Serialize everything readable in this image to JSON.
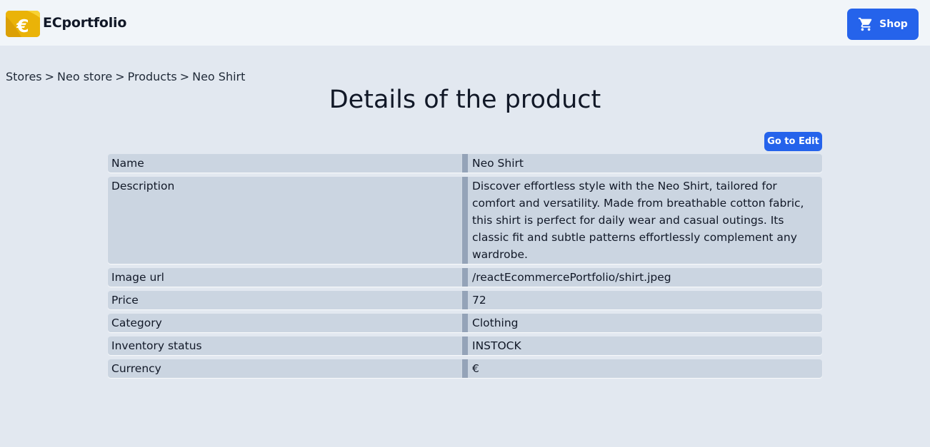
{
  "header": {
    "brand": "ECportfolio",
    "logo_icon": "euro-wallet-icon",
    "logo_color": "#eab308",
    "shop_label": "Shop",
    "shop_icon": "cart-icon",
    "accent_color": "#2563eb"
  },
  "breadcrumb": {
    "items": [
      "Stores",
      "Neo store",
      "Products",
      "Neo Shirt"
    ],
    "separator": ">"
  },
  "page": {
    "title": "Details of the product",
    "edit_label": "Go to Edit"
  },
  "details": [
    {
      "label": "Name",
      "value": "Neo Shirt"
    },
    {
      "label": "Description",
      "value": "Discover effortless style with the Neo Shirt, tailored for comfort and versatility. Made from breathable cotton fabric, this shirt is perfect for daily wear and casual outings. Its classic fit and subtle patterns effortlessly complement any wardrobe."
    },
    {
      "label": "Image url",
      "value": "/reactEcommercePortfolio/shirt.jpeg"
    },
    {
      "label": "Price",
      "value": "72"
    },
    {
      "label": "Category",
      "value": "Clothing"
    },
    {
      "label": "Inventory status",
      "value": "INSTOCK"
    },
    {
      "label": "Currency",
      "value": "€"
    }
  ]
}
